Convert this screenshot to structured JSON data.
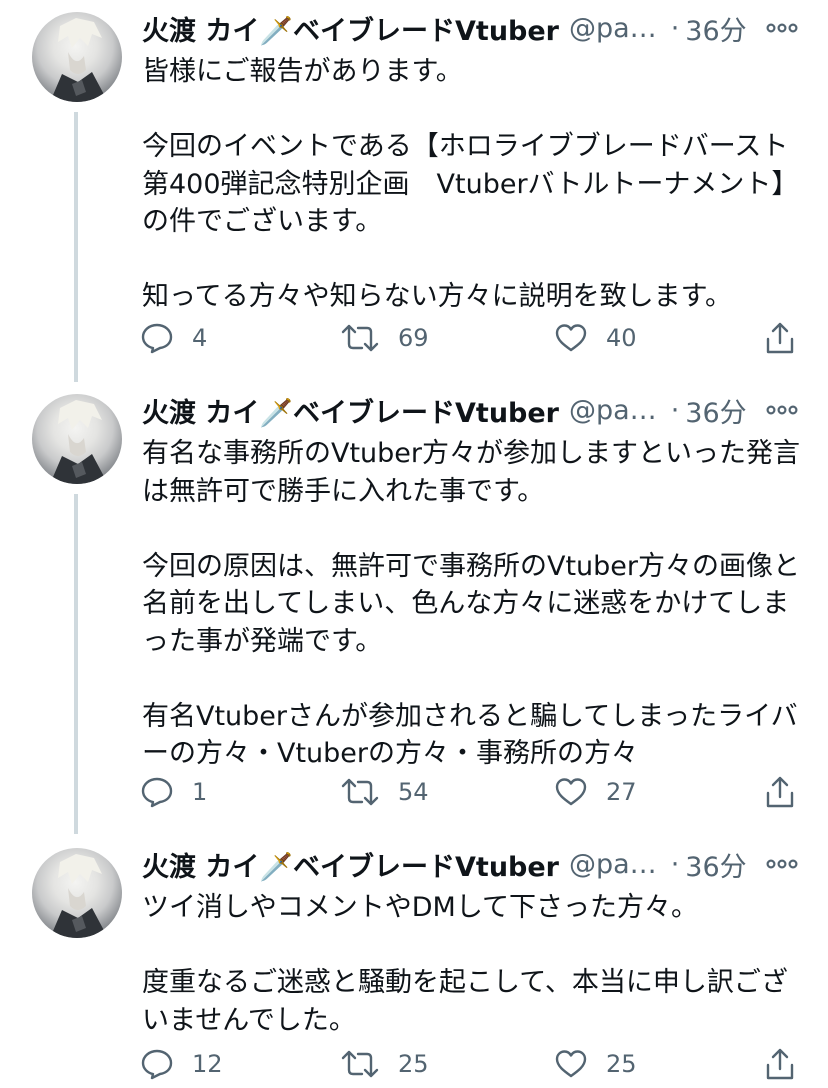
{
  "tweets": [
    {
      "author_name": "火渡 カイ🗡️ベイブレードVtuber",
      "handle": "@pa…",
      "separator": "·",
      "time": "36分",
      "text": "皆様にご報告があります。\n\n今回のイベントである【ホロライブブレードバースト 第400弾記念特別企画　Vtuberバトルトーナメント】の件でございます。\n\n知ってる方々や知らない方々に説明を致します。",
      "replies": "4",
      "retweets": "69",
      "likes": "40"
    },
    {
      "author_name": "火渡 カイ🗡️ベイブレードVtuber",
      "handle": "@pa…",
      "separator": "·",
      "time": "36分",
      "text": "有名な事務所のVtuber方々が参加しますといった発言は無許可で勝手に入れた事です。\n\n今回の原因は、無許可で事務所のVtuber方々の画像と名前を出してしまい、色んな方々に迷惑をかけてしまった事が発端です。\n\n有名Vtuberさんが参加されると騙してしまったライバーの方々・Vtuberの方々・事務所の方々",
      "replies": "1",
      "retweets": "54",
      "likes": "27"
    },
    {
      "author_name": "火渡 カイ🗡️ベイブレードVtuber",
      "handle": "@pa…",
      "separator": "·",
      "time": "36分",
      "text": "ツイ消しやコメントやDMして下さった方々。\n\n度重なるご迷惑と騒動を起こして、本当に申し訳ございませんでした。",
      "replies": "12",
      "retweets": "25",
      "likes": "25"
    }
  ],
  "icons": {
    "avatar": "avatar-image",
    "more": "more-options-icon",
    "reply": "reply-icon",
    "retweet": "retweet-icon",
    "like": "like-icon",
    "share": "share-icon"
  },
  "colors": {
    "text": "#0f1419",
    "secondary": "#536471",
    "thread_line": "#cfd9de",
    "background": "#ffffff"
  }
}
